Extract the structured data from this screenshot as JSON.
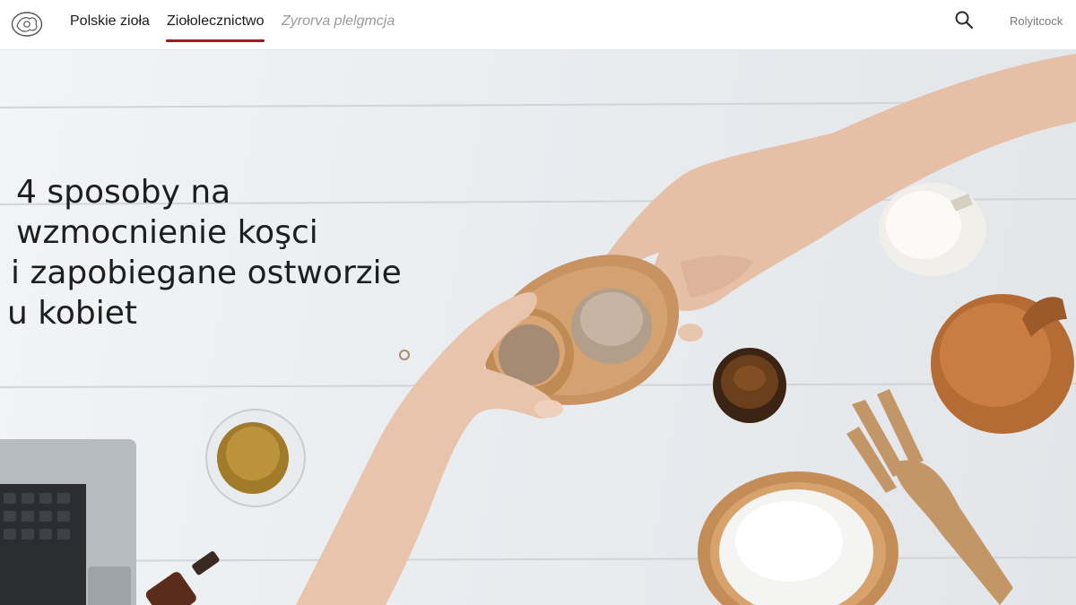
{
  "nav": {
    "logo_icon": "herb-logo-icon",
    "items": [
      {
        "label": "Polskie zioła"
      },
      {
        "label": "Ziołolecznictwo",
        "active": true
      },
      {
        "label": "Zyrorva plelgmcja"
      }
    ],
    "active_color": "#9a1d25",
    "search_icon": "search-icon",
    "account_label": "Rolyitcock"
  },
  "hero": {
    "headline_lines": [
      "4 sposoby na",
      "wzmocnienie koşci",
      "i zapobiegane ostworzie",
      "u kobiet"
    ]
  }
}
